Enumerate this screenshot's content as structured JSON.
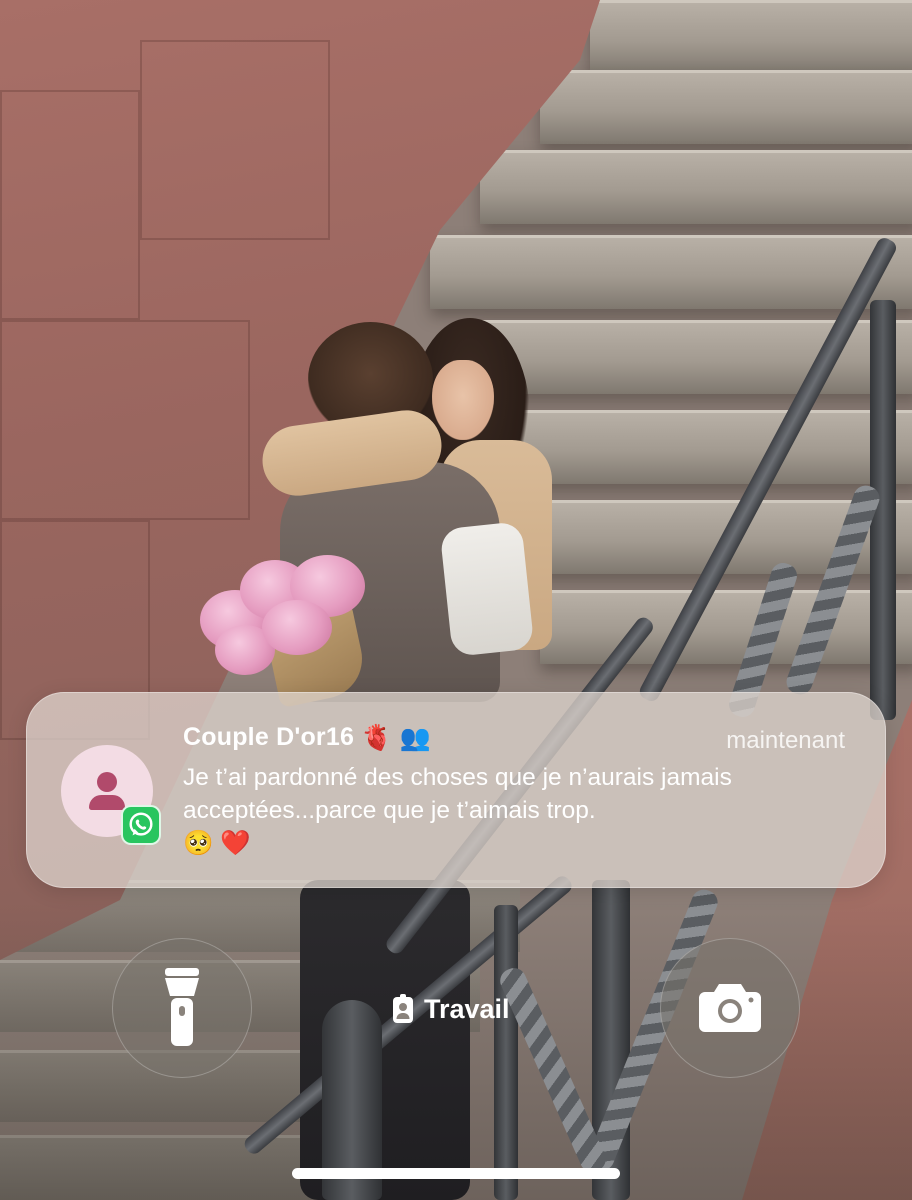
{
  "notification": {
    "sender": "Couple D'or16",
    "sender_emojis": [
      "🫀",
      "👥"
    ],
    "time": "maintenant",
    "message": "Je t’ai pardonné des choses que je n’aurais jamais acceptées...parce que je t’aimais trop.",
    "message_emojis": "🥺 ❤️",
    "app_icon": "whatsapp-icon",
    "avatar_icon": "person-icon"
  },
  "lockscreen": {
    "focus_mode_label": "Travail",
    "focus_mode_icon": "badge-icon",
    "left_button_icon": "flashlight-icon",
    "right_button_icon": "camera-icon"
  },
  "colors": {
    "whatsapp_green": "#28c55f",
    "avatar_background": "#f3dce4",
    "avatar_person": "#b14a6b",
    "card_background": "#e0d7d0"
  }
}
